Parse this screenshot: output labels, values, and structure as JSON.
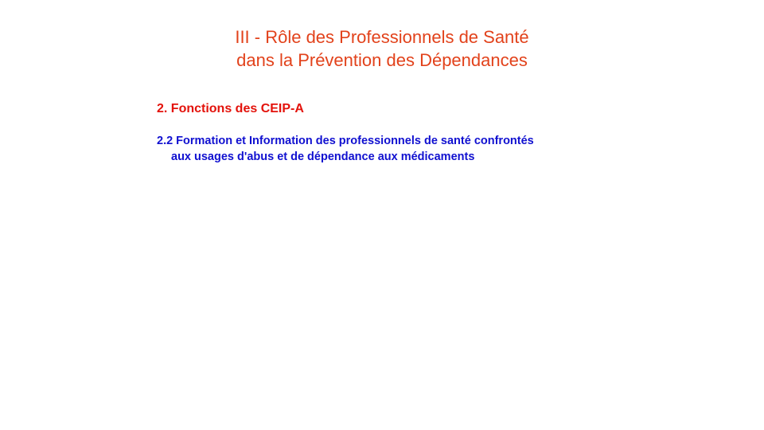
{
  "slide": {
    "title_line1": "III  - Rôle des Professionnels de Santé",
    "title_line2": "dans la Prévention des Dépendances",
    "section_heading": "2. Fonctions des CEIP-A",
    "subsection_line1": "2.2 Formation et Information  des professionnels de santé confrontés",
    "subsection_line2": "aux usages d'abus et de dépendance aux médicaments"
  },
  "colors": {
    "title": "#e2421b",
    "section_heading": "#e3120b",
    "subsection": "#1010d0",
    "background": "#ffffff"
  }
}
